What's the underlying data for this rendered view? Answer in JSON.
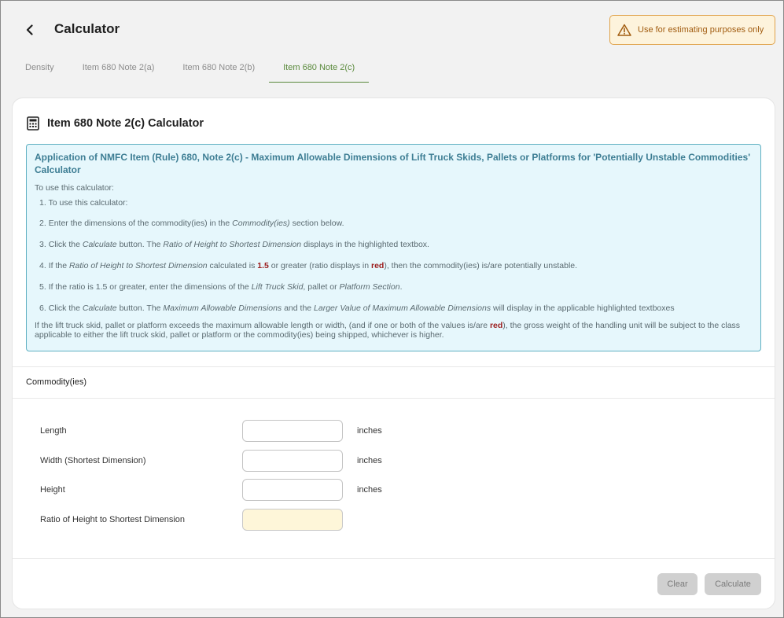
{
  "header": {
    "title": "Calculator",
    "warning": "Use for estimating purposes only"
  },
  "tabs": [
    {
      "label": "Density"
    },
    {
      "label": "Item 680 Note 2(a)"
    },
    {
      "label": "Item 680 Note 2(b)"
    },
    {
      "label": "Item 680 Note 2(c)"
    }
  ],
  "card": {
    "title": "Item 680 Note 2(c) Calculator"
  },
  "info": {
    "heading": "Application of NMFC Item (Rule) 680, Note 2(c) - Maximum Allowable Dimensions of Lift Truck Skids, Pallets or Platforms for 'Potentially Unstable Commodities' Calculator",
    "intro": "To use this calculator:",
    "steps": {
      "s1": {
        "num": "1.",
        "text": "To use this calculator:"
      },
      "s2": {
        "num": "2.",
        "a": "Enter the dimensions of the commodity(ies) in the ",
        "b": "Commodity(ies)",
        "c": " section below."
      },
      "s3": {
        "num": "3.",
        "a": "Click the ",
        "b": "Calculate",
        "c": " button. The ",
        "d": "Ratio of Height to Shortest Dimension",
        "e": " displays in the highlighted textbox."
      },
      "s4": {
        "num": "4.",
        "a": "If the ",
        "b": "Ratio of Height to Shortest Dimension",
        "c": " calculated is ",
        "d": "1.5",
        "e": " or greater (ratio displays in ",
        "f": "red",
        "g": "), then the commodity(ies) is/are potentially unstable."
      },
      "s5": {
        "num": "5.",
        "a": "If the ratio is 1.5 or greater, enter the dimensions of the ",
        "b": "Lift Truck Skid",
        "c": ", pallet or ",
        "d": "Platform Section",
        "e": "."
      },
      "s6": {
        "num": "6.",
        "a": "Click the ",
        "b": "Calculate",
        "c": " button. The ",
        "d": "Maximum Allowable Dimensions",
        "e": " and the ",
        "f": "Larger Value of Maximum Allowable Dimensions",
        "g": " will display in the applicable highlighted textboxes"
      }
    },
    "footer": {
      "a": "If the lift truck skid, pallet or platform exceeds the maximum allowable length or width, (and if one or both of the values is/are ",
      "b": "red",
      "c": "), the gross weight of the handling unit will be subject to the class applicable to either the lift truck skid, pallet or platform or the commodity(ies) being shipped, whichever is higher."
    }
  },
  "section": {
    "title": "Commodity(ies)"
  },
  "form": {
    "length": {
      "label": "Length",
      "value": "",
      "unit": "inches"
    },
    "width": {
      "label": "Width (Shortest Dimension)",
      "value": "",
      "unit": "inches"
    },
    "height": {
      "label": "Height",
      "value": "",
      "unit": "inches"
    },
    "ratio": {
      "label": "Ratio of Height to Shortest Dimension",
      "value": ""
    }
  },
  "buttons": {
    "clear": "Clear",
    "calculate": "Calculate"
  },
  "colors": {
    "accent": "#5a8a3c",
    "info_border": "#5fb0c2",
    "warning": "#e0a24a",
    "result_bg": "#fef6d9"
  },
  "icons": {
    "back": "chevron-left-icon",
    "warning": "warning-triangle-icon",
    "calculator": "calculator-icon"
  }
}
